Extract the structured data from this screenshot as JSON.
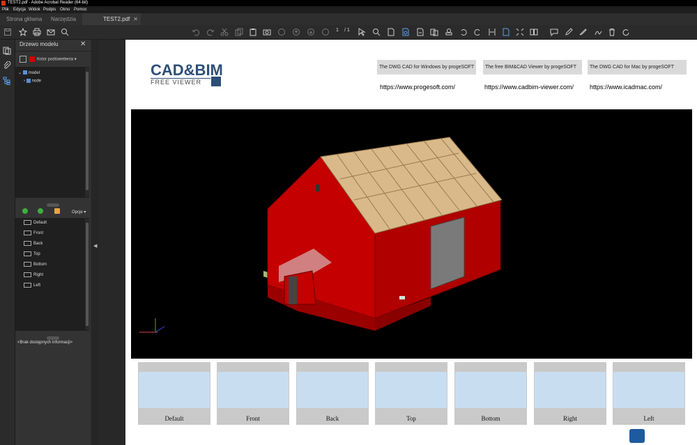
{
  "window": {
    "title": "TEST2.pdf - Adobe Acrobat Reader (64-bit)"
  },
  "menu": [
    "Plik",
    "Edycja",
    "Widok",
    "Podpis",
    "Okno",
    "Pomoc"
  ],
  "tabs": {
    "home": "Strona główna",
    "tools": "Narzędzia",
    "document": "TEST2.pdf"
  },
  "toolbar": {
    "page_current": "1",
    "page_total": "/ 1"
  },
  "panel": {
    "title": "Drzewo modelu",
    "highlight_color_label": "Kolor podświetlenia",
    "highlight_color": "#d10000",
    "tree": [
      {
        "label": "model"
      },
      {
        "label": "node"
      }
    ],
    "options_label": "Opcje",
    "views": [
      "Default",
      "Front",
      "Back",
      "Top",
      "Bottom",
      "Right",
      "Left"
    ],
    "info": "<Brak dostępnych informacji>"
  },
  "pdf": {
    "logo_main": "CAD&BIM",
    "logo_sub": "FREE VIEWER",
    "promos": [
      {
        "title": "The DWG CAD for Windows by progeSOFT",
        "url": "https://www.progesoft.com/"
      },
      {
        "title": "The free BIM&CAD Viewer by progeSOFT",
        "url": "https://www.cadbim-viewer.com/"
      },
      {
        "title": "The DWG CAD for Mac by progeSOFT",
        "url": "https://www.icadmac.com/"
      }
    ],
    "thumbnails": [
      "Default",
      "Front",
      "Back",
      "Top",
      "Bottom",
      "Right",
      "Left"
    ]
  },
  "colors": {
    "building_red": "#c40000",
    "roof_wood": "#d9b98a",
    "ground_band": "#a8b878",
    "accent_blue": "#5aa0f0"
  }
}
